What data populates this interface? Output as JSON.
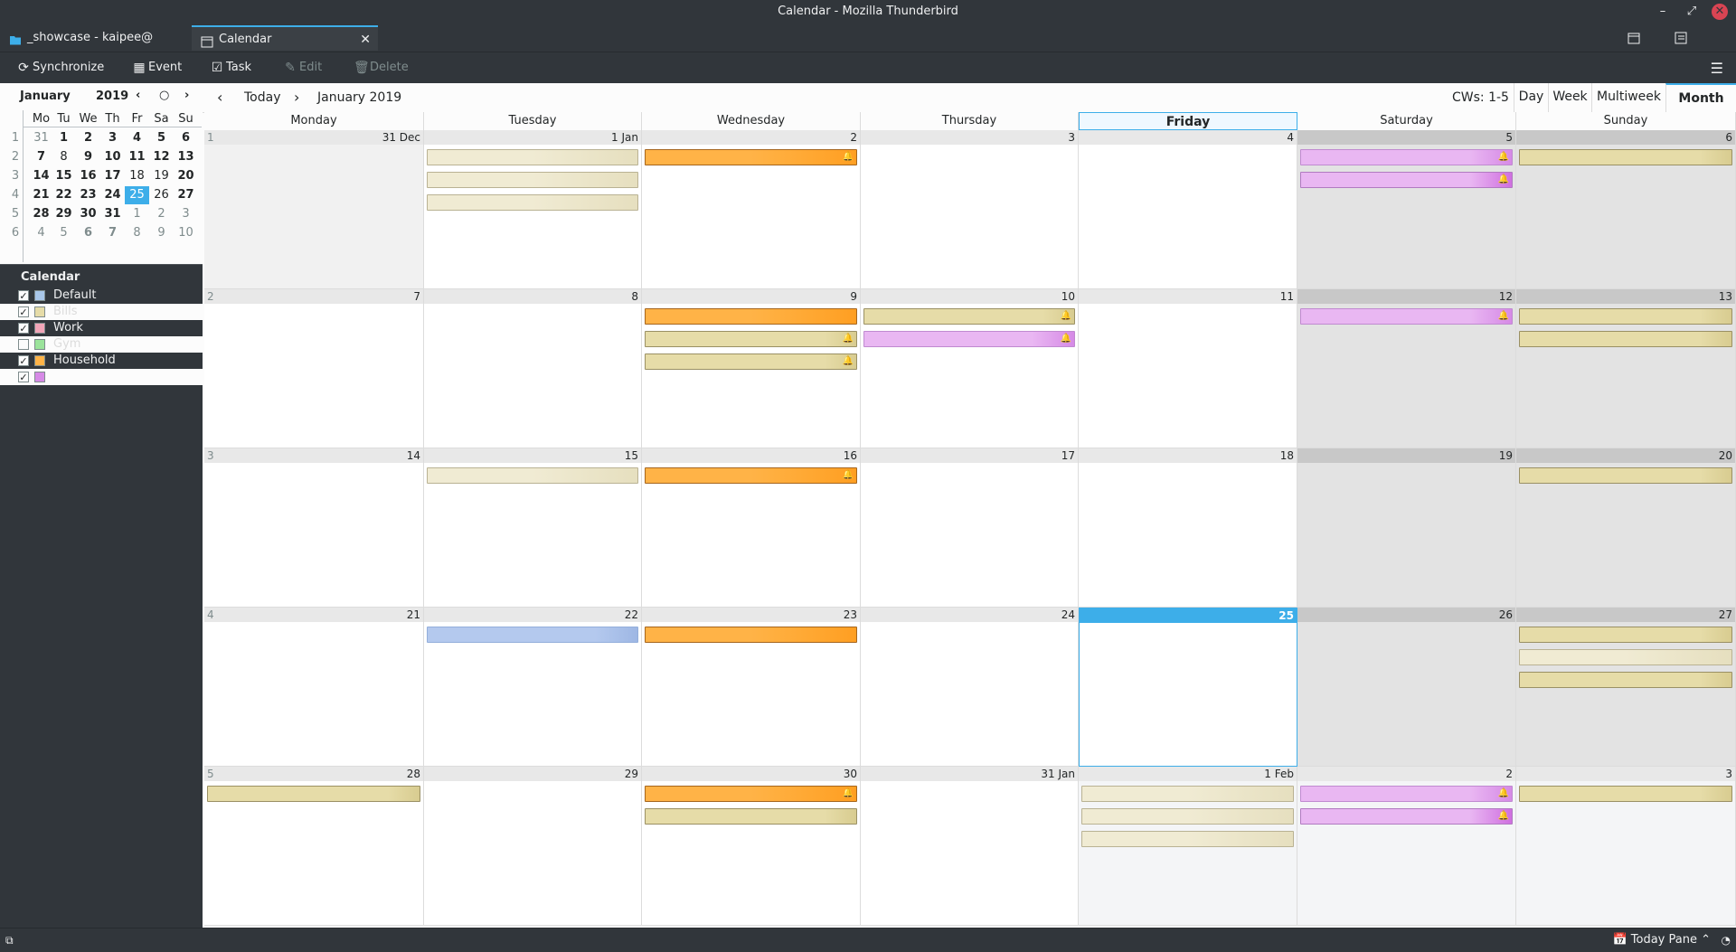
{
  "window": {
    "title": "Calendar - Mozilla Thunderbird"
  },
  "tabs": [
    {
      "label": "_showcase - kaipee@",
      "icon": "folder-icon"
    },
    {
      "label": "Calendar",
      "icon": "calendar-icon",
      "close": "✕"
    }
  ],
  "toolbar": {
    "synchronize": "Synchronize",
    "event": "Event",
    "task": "Task",
    "edit": "Edit",
    "delete": "Delete"
  },
  "minimonth": {
    "month": "January",
    "year": "2019",
    "weekday_headers": [
      "Mo",
      "Tu",
      "We",
      "Th",
      "Fr",
      "Sa",
      "Su"
    ],
    "weeks": [
      {
        "wk": "1",
        "days": [
          "31",
          "1",
          "2",
          "3",
          "4",
          "5",
          "6"
        ]
      },
      {
        "wk": "2",
        "days": [
          "7",
          "8",
          "9",
          "10",
          "11",
          "12",
          "13"
        ]
      },
      {
        "wk": "3",
        "days": [
          "14",
          "15",
          "16",
          "17",
          "18",
          "19",
          "20"
        ]
      },
      {
        "wk": "4",
        "days": [
          "21",
          "22",
          "23",
          "24",
          "25",
          "26",
          "27"
        ]
      },
      {
        "wk": "5",
        "days": [
          "28",
          "29",
          "30",
          "31",
          "1",
          "2",
          "3"
        ]
      },
      {
        "wk": "6",
        "days": [
          "4",
          "5",
          "6",
          "7",
          "8",
          "9",
          "10"
        ]
      }
    ]
  },
  "calendars": {
    "header": "Calendar",
    "items": [
      {
        "name": "Default",
        "color": "#a8c6e8",
        "checked": true
      },
      {
        "name": "Bills",
        "color": "#e6dca8",
        "checked": true
      },
      {
        "name": "Work",
        "color": "#f2a5b8",
        "checked": true
      },
      {
        "name": "Gym",
        "color": "#9be39b",
        "checked": false
      },
      {
        "name": "Household",
        "color": "#ffb347",
        "checked": true
      },
      {
        "name": "",
        "color": "#d68ae6",
        "checked": true
      }
    ]
  },
  "nav": {
    "today": "Today",
    "period": "January 2019",
    "cws": "CWs: 1-5",
    "views": [
      "Day",
      "Week",
      "Multiweek",
      "Month"
    ],
    "selected_view": "Month"
  },
  "grid": {
    "day_headers": [
      "Monday",
      "Tuesday",
      "Wednesday",
      "Thursday",
      "Friday",
      "Saturday",
      "Sunday"
    ],
    "selected_header": "Friday",
    "weeks": [
      {
        "wk": "1",
        "days": [
          "31 Dec",
          "1 Jan",
          "2",
          "3",
          "4",
          "5",
          "6"
        ]
      },
      {
        "wk": "2",
        "days": [
          "7",
          "8",
          "9",
          "10",
          "11",
          "12",
          "13"
        ]
      },
      {
        "wk": "3",
        "days": [
          "14",
          "15",
          "16",
          "17",
          "18",
          "19",
          "20"
        ]
      },
      {
        "wk": "4",
        "days": [
          "21",
          "22",
          "23",
          "24",
          "25",
          "26",
          "27"
        ]
      },
      {
        "wk": "5",
        "days": [
          "28",
          "29",
          "30",
          "31 Jan",
          "1 Feb",
          "2",
          "3"
        ]
      }
    ]
  },
  "status": {
    "today_pane": "Today Pane"
  }
}
